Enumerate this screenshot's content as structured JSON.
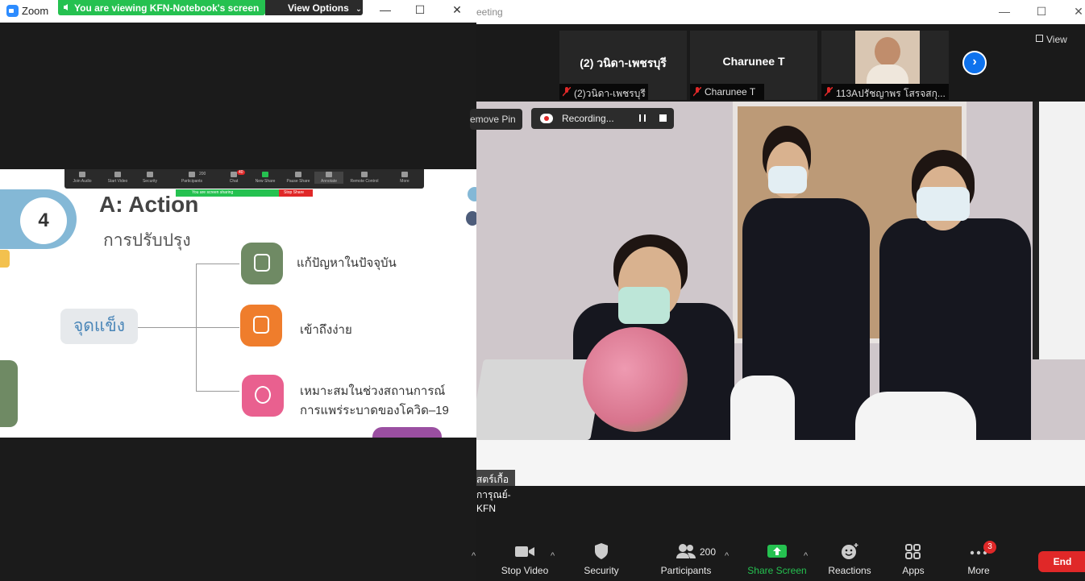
{
  "share_window": {
    "app_name": "Zoom",
    "banner_text": "You are viewing KFN-Notebook's screen",
    "view_options_label": "View Options",
    "mini_toolbar": {
      "items": [
        "Join Audio",
        "Start Video",
        "Security",
        "Participants",
        "Chat",
        "New Share",
        "Pause Share",
        "Annotate",
        "Remote Control",
        "More"
      ],
      "participants_count": "200",
      "chat_badge": "40",
      "banner": "You are screen sharing",
      "stop_share": "Stop Share"
    },
    "slide": {
      "step_number": "4",
      "title": "A: Action",
      "subtitle": "การปรับปรุง",
      "center_label": "จุดแข็ง",
      "branches": [
        {
          "icon": "user-icon",
          "text_lines": [
            "แก้ปัญหาในปัจจุบัน"
          ],
          "color": "#6f8a64"
        },
        {
          "icon": "document-edit-icon",
          "text_lines": [
            "เข้าถึงง่าย"
          ],
          "color": "#ef7d2c"
        },
        {
          "icon": "virus-icon",
          "text_lines": [
            "เหมาะสมในช่วงสถานการณ์",
            "การแพร่ระบาดของโควิด–19"
          ],
          "color": "#e9608f"
        }
      ]
    }
  },
  "meeting": {
    "title_fragment": "eeting",
    "thumbnails": [
      {
        "display_name": "(2) วนิดา-เพชรบุรี",
        "label": "(2)วนิดา-เพชรบุรี",
        "muted": true,
        "has_video": false
      },
      {
        "display_name": "Charunee T",
        "label": "Charunee T",
        "muted": true,
        "has_video": false
      },
      {
        "display_name": "",
        "label": "113Aปรัชญาพร โสรจสกุ...",
        "muted": true,
        "has_video": true
      }
    ],
    "view_label": "View",
    "remove_pin_label": "emove Pin",
    "recording_label": "Recording...",
    "main_video_name": "สตร์เกื้อการุณย์-KFN",
    "toolbar": {
      "stop_video": "Stop Video",
      "security": "Security",
      "participants": "Participants",
      "participants_count": "200",
      "share_screen": "Share Screen",
      "reactions": "Reactions",
      "apps": "Apps",
      "more": "More",
      "more_badge": "3",
      "end": "End"
    },
    "colors": {
      "share_green": "#25c150",
      "end_red": "#e02828",
      "accent_blue": "#0e72ed"
    }
  }
}
